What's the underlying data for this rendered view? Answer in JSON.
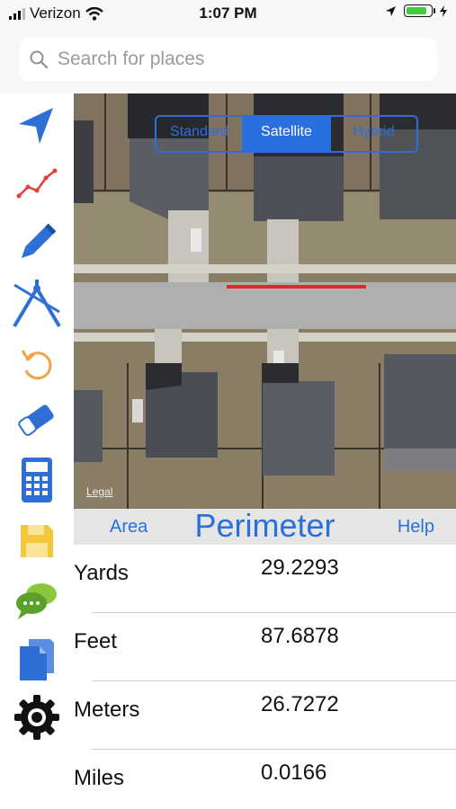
{
  "status_bar": {
    "carrier": "Verizon",
    "time": "1:07 PM"
  },
  "search": {
    "placeholder": "Search for places"
  },
  "toolbar": {
    "items": [
      {
        "icon": "location-arrow-icon"
      },
      {
        "icon": "line-chart-icon"
      },
      {
        "icon": "pencil-icon"
      },
      {
        "icon": "dividers-icon"
      },
      {
        "icon": "undo-icon"
      },
      {
        "icon": "eraser-icon"
      },
      {
        "icon": "calculator-icon"
      },
      {
        "icon": "save-icon"
      },
      {
        "icon": "chat-icon"
      },
      {
        "icon": "document-icon"
      },
      {
        "icon": "settings-gear-icon"
      }
    ]
  },
  "map": {
    "segments": [
      "Standard",
      "Satellite",
      "Hybrid"
    ],
    "selected_segment": "Satellite",
    "legal": "Legal"
  },
  "modes": {
    "area": "Area",
    "current": "Perimeter",
    "help": "Help"
  },
  "results": [
    {
      "label": "Yards",
      "value": "29.2293"
    },
    {
      "label": "Feet",
      "value": "87.6878"
    },
    {
      "label": "Meters",
      "value": "26.7272"
    },
    {
      "label": "Miles",
      "value": "0.0166"
    }
  ],
  "colors": {
    "accent": "#2a6fe0",
    "measure_line": "#e02a2a"
  }
}
